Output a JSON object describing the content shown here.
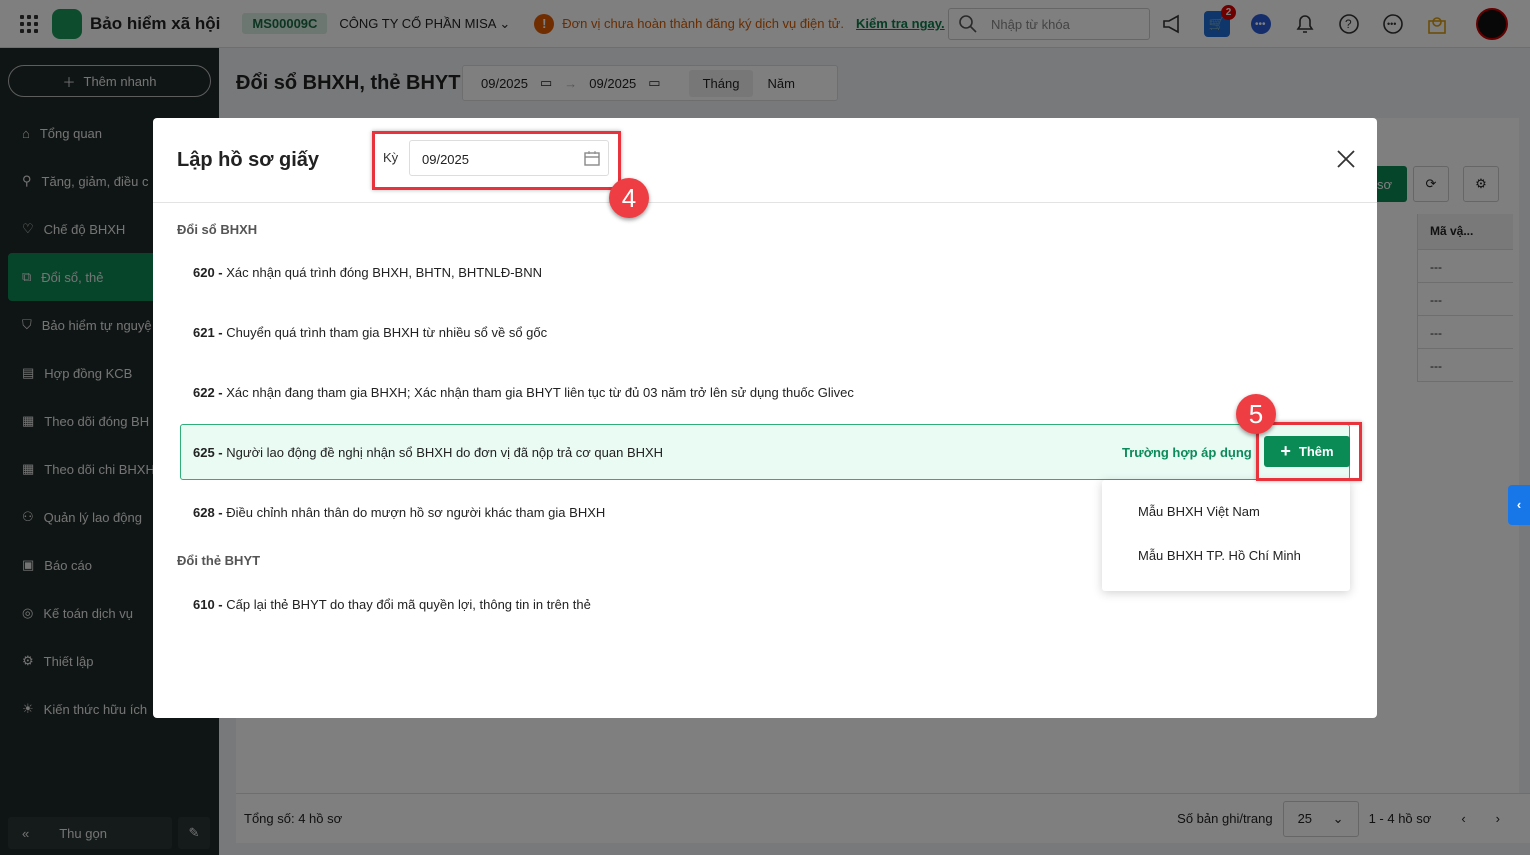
{
  "topbar": {
    "app_title": "Bảo hiểm xã hội",
    "company_code": "MS00009C",
    "company_name": "CÔNG TY CỔ PHẦN MISA",
    "warning_text": "Đơn vị chưa hoàn thành đăng ký dịch vụ điện tử.",
    "warning_link": "Kiểm tra ngay.",
    "search_placeholder": "Nhập từ khóa",
    "cart_badge": "2"
  },
  "sidebar": {
    "quick_add": "Thêm nhanh",
    "items": [
      {
        "label": "Tổng quan"
      },
      {
        "label": "Tăng, giảm, điều c"
      },
      {
        "label": "Chế độ BHXH"
      },
      {
        "label": "Đổi sổ, thẻ"
      },
      {
        "label": "Bảo hiểm tự nguyệ"
      },
      {
        "label": "Hợp đồng KCB"
      },
      {
        "label": "Theo dõi đóng BH"
      },
      {
        "label": "Theo dõi chi BHXH"
      },
      {
        "label": "Quản lý lao động"
      },
      {
        "label": "Báo cáo"
      },
      {
        "label": "Kế toán dịch vụ"
      },
      {
        "label": "Thiết lập"
      },
      {
        "label": "Kiến thức hữu ích"
      }
    ],
    "collapse": "Thu gọn"
  },
  "page": {
    "title": "Đổi sổ BHXH, thẻ BHYT",
    "date_from": "09/2025",
    "date_to": "09/2025",
    "tabs": [
      "Tháng",
      "Năm"
    ],
    "green_btn_partial": "sơ",
    "table_header": "Mã vậ...",
    "table_cells": [
      "---",
      "---",
      "---",
      "---"
    ],
    "footer_total": "Tổng số: 4 hồ sơ",
    "per_page_label": "Số bản ghi/trang",
    "per_page": "25",
    "range": "1 - 4 hồ sơ"
  },
  "modal": {
    "title": "Lập hồ sơ giấy",
    "period_label": "Kỳ",
    "period_value": "09/2025",
    "step4": "4",
    "step5": "5",
    "section1": "Đổi sổ BHXH",
    "section2": "Đổi thẻ BHYT",
    "rows": [
      {
        "code": "620 -",
        "text": " Xác nhận quá trình đóng BHXH, BHTN, BHTNLĐ-BNN"
      },
      {
        "code": "621 -",
        "text": " Chuyển quá trình tham gia BHXH từ nhiều sổ về sổ gốc"
      },
      {
        "code": "622 -",
        "text": " Xác nhận đang tham gia BHXH; Xác nhận tham gia BHYT liên tục từ đủ 03 năm trở lên sử dụng thuốc Glivec"
      },
      {
        "code": "625 -",
        "text": " Người lao động đề nghị nhận sổ BHXH do đơn vị đã nộp trả cơ quan BHXH"
      },
      {
        "code": "628 -",
        "text": " Điều chỉnh nhân thân do mượn hồ sơ người khác tham gia BHXH"
      },
      {
        "code": "610 -",
        "text": " Cấp lại thẻ BHYT do thay đổi mã quyền lợi, thông tin in trên thẻ"
      }
    ],
    "apply_link": "Trường hợp áp dụng",
    "add_button": "Thêm",
    "dropdown": [
      "Mẫu BHXH Việt Nam",
      "Mẫu BHXH TP. Hồ Chí Minh"
    ]
  },
  "colors": {
    "accent": "#0a8a55",
    "highlight": "#e8323c"
  }
}
